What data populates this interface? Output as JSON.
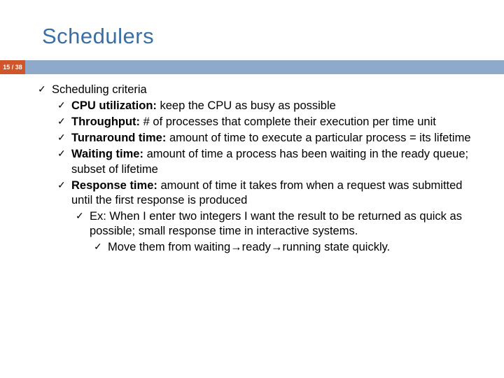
{
  "title": "Schedulers",
  "page": "15 / 38",
  "heading": "Scheduling criteria",
  "items": [
    {
      "term": "CPU utilization: ",
      "desc": "keep the CPU as busy as possible"
    },
    {
      "term": "Throughput: ",
      "desc": "# of processes that complete their execution per time unit"
    },
    {
      "term": "Turnaround time: ",
      "desc": "amount of time to execute a particular process = its lifetime"
    },
    {
      "term": "Waiting time: ",
      "desc": "amount of time a process has been waiting in the ready queue; subset of lifetime"
    },
    {
      "term": "Response time: ",
      "desc": "amount of time it takes from when a request was submitted until the first response is produced"
    }
  ],
  "sub1": "Ex: When I enter two integers I want the result to be returned as quick as possible; small response time in interactive systems.",
  "sub2_pre": "Move them from waiting",
  "sub2_mid": "ready",
  "sub2_post": "running state quickly."
}
